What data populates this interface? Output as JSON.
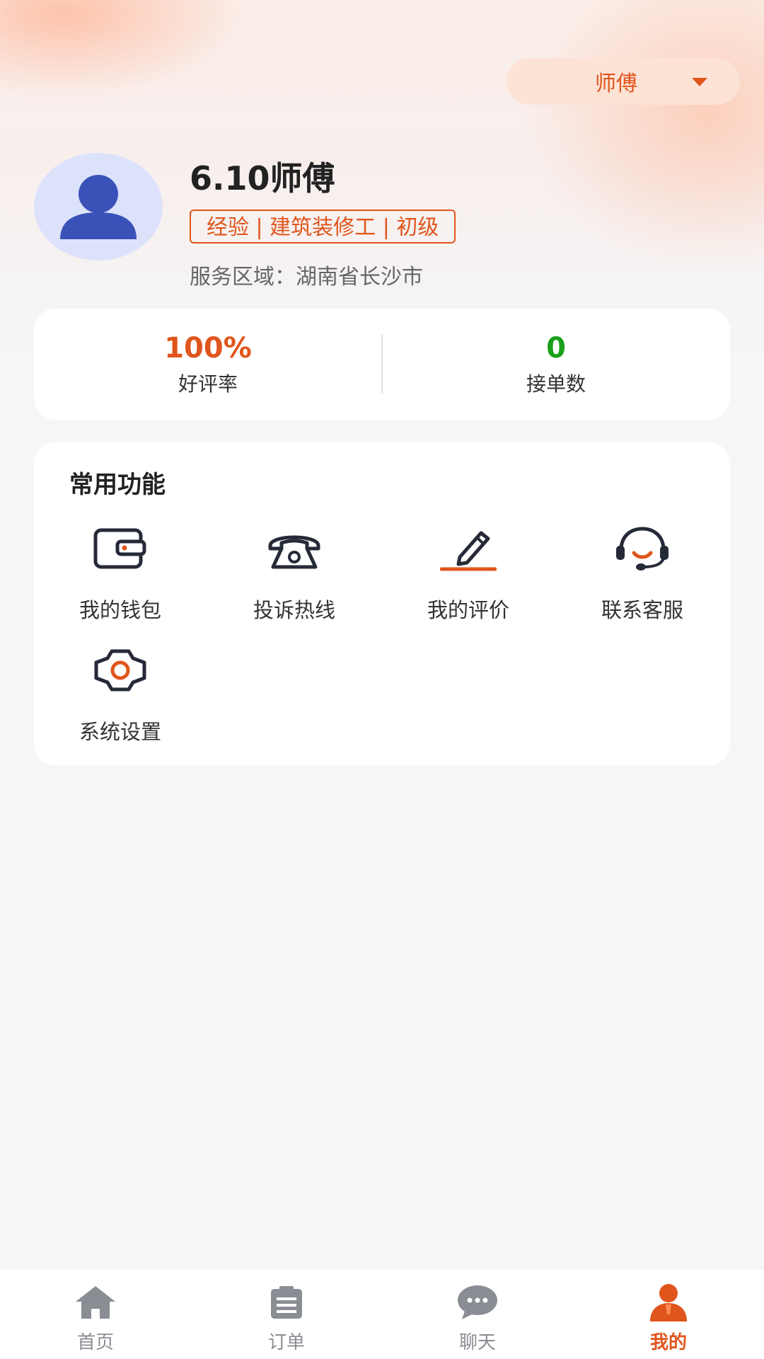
{
  "header": {
    "role_switch": "师傅"
  },
  "profile": {
    "name": "6.10师傅",
    "tag": "经验 | 建筑装修工 | 初级",
    "service_area": "服务区域：湖南省长沙市"
  },
  "stats": [
    {
      "value": "100%",
      "label": "好评率",
      "color": "#e0551c"
    },
    {
      "value": "0",
      "label": "接单数",
      "color": "#1aa01a"
    }
  ],
  "functions": {
    "title": "常用功能",
    "items": [
      {
        "label": "我的钱包",
        "icon": "wallet-icon"
      },
      {
        "label": "投诉热线",
        "icon": "phone-icon"
      },
      {
        "label": "我的评价",
        "icon": "edit-pen-icon"
      },
      {
        "label": "联系客服",
        "icon": "headset-icon"
      },
      {
        "label": "系统设置",
        "icon": "gear-icon"
      }
    ]
  },
  "tabbar": {
    "items": [
      {
        "label": "首页",
        "icon": "home-icon",
        "active": false
      },
      {
        "label": "订单",
        "icon": "clipboard-icon",
        "active": false
      },
      {
        "label": "聊天",
        "icon": "chat-bubble-icon",
        "active": false
      },
      {
        "label": "我的",
        "icon": "person-icon",
        "active": true
      }
    ],
    "active_color": "#e0551c",
    "inactive_color": "#8a8d93"
  }
}
